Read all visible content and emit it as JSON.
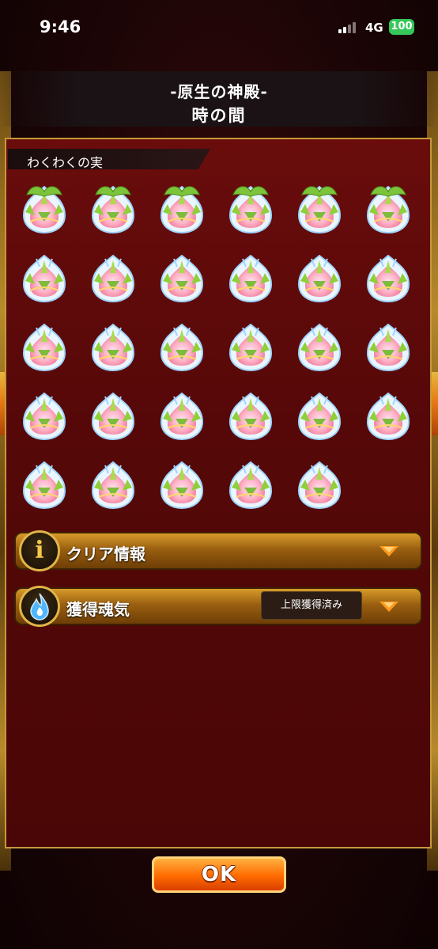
{
  "status": {
    "time": "9:46",
    "network": "4G",
    "battery": "100"
  },
  "header": {
    "title_line1": "-原生の神殿-",
    "title_line2": "時の間"
  },
  "section": {
    "label": "わくわくの実"
  },
  "fruits": {
    "total": 29,
    "leafy_count": 6,
    "icon": "lotus-fruit-icon"
  },
  "rows": [
    {
      "label": "クリア情報",
      "icon": "info-icon"
    },
    {
      "label": "獲得魂気",
      "icon": "soul-flame-icon",
      "badge": "上限獲得済み"
    }
  ],
  "ok_button": {
    "label": "OK"
  }
}
